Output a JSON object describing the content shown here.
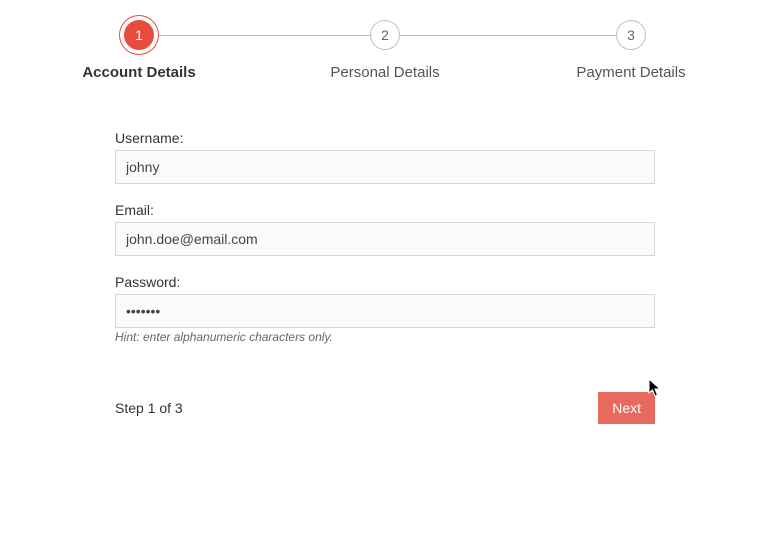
{
  "stepper": {
    "steps": [
      {
        "num": "1",
        "label": "Account Details",
        "active": true
      },
      {
        "num": "2",
        "label": "Personal Details",
        "active": false
      },
      {
        "num": "3",
        "label": "Payment Details",
        "active": false
      }
    ]
  },
  "form": {
    "username": {
      "label": "Username:",
      "value": "johny"
    },
    "email": {
      "label": "Email:",
      "value": "john.doe@email.com"
    },
    "password": {
      "label": "Password:",
      "value": "•••••••"
    },
    "hint": "Hint: enter alphanumeric characters only."
  },
  "footer": {
    "step_text": "Step 1 of 3",
    "next_label": "Next"
  }
}
